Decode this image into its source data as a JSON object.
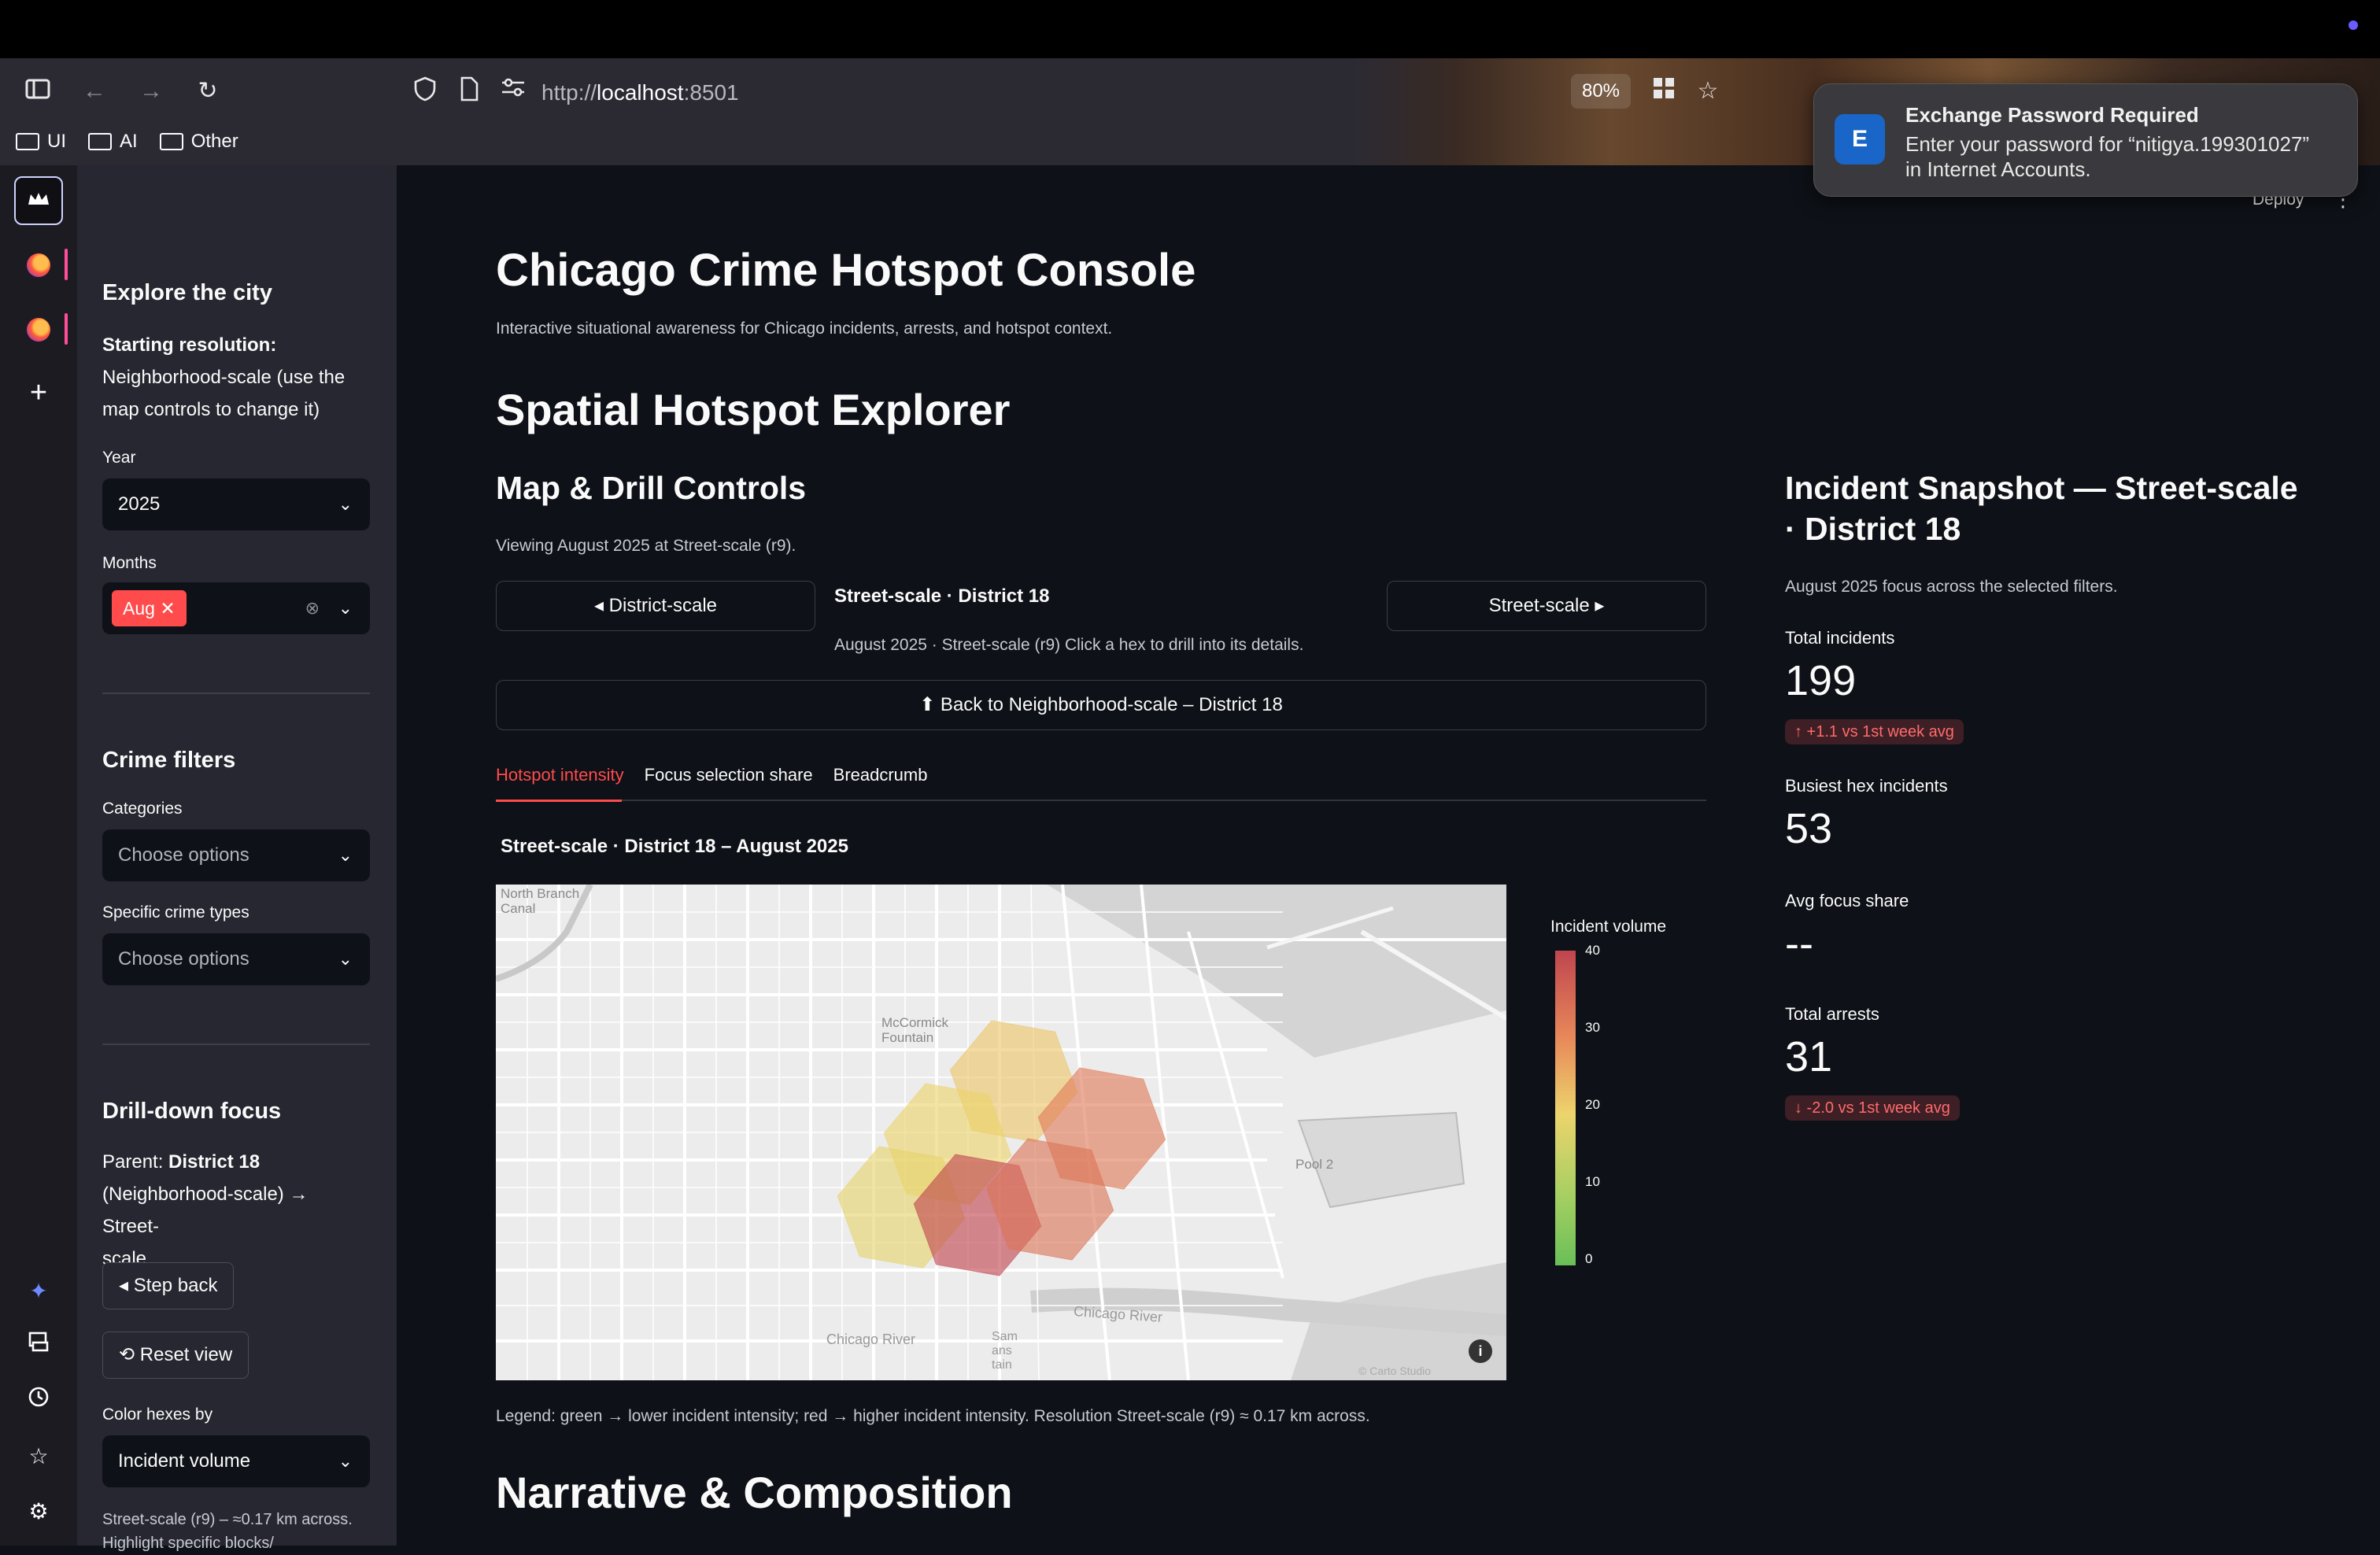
{
  "browser": {
    "url_host": "localhost",
    "url_scheme": "http://",
    "url_port": ":8501",
    "zoom": "80%",
    "bookmarks": [
      "UI",
      "AI",
      "Other"
    ]
  },
  "notification": {
    "icon_text": "E",
    "title": "Exchange Password Required",
    "body_line1": "Enter your password for “nitigya.199301027”",
    "body_line2": "in Internet Accounts."
  },
  "app": {
    "deploy_label": "Deploy",
    "title": "Chicago Crime Hotspot Console",
    "subtitle": "Interactive situational awareness for Chicago incidents, arrests, and hotspot context.",
    "section_title": "Spatial Hotspot Explorer",
    "next_section_title": "Narrative & Composition"
  },
  "sidebar": {
    "explore_heading": "Explore the city",
    "starting_res_bold": "Starting resolution:",
    "starting_res_text1": "Neighborhood-scale (use the",
    "starting_res_text2": "map controls to change it)",
    "year_label": "Year",
    "year_value": "2025",
    "months_label": "Months",
    "month_tag": "Aug",
    "crime_heading": "Crime filters",
    "categories_label": "Categories",
    "categories_placeholder": "Choose options",
    "types_label": "Specific crime types",
    "types_placeholder": "Choose options",
    "drill_heading": "Drill-down focus",
    "parent_prefix": "Parent: ",
    "parent_bold": "District 18",
    "parent_line2": "(Neighborhood-scale) → Street-",
    "parent_line3": "scale",
    "step_back": "◂ Step back",
    "reset_view": "⟲ Reset view",
    "color_by_label": "Color hexes by",
    "color_by_value": "Incident volume",
    "footer_line1": "Street-scale (r9) – ≈0.17 km across.",
    "footer_line2": "Highlight specific blocks/"
  },
  "controls": {
    "heading": "Map & Drill Controls",
    "viewing": "Viewing August 2025 at Street-scale (r9).",
    "prev_btn": "◂ District-scale",
    "current_label": "Street-scale · District 18",
    "current_caption": "August 2025 · Street-scale (r9) Click a hex to drill into its details.",
    "next_btn": "Street-scale ▸",
    "back_btn": "⬆ Back to Neighborhood-scale – District 18",
    "tabs": [
      "Hotspot intensity",
      "Focus selection share",
      "Breadcrumb"
    ],
    "map_title": "Street-scale · District 18 – August 2025",
    "legend_caption": "Legend: green → lower incident intensity; red → higher incident intensity. Resolution Street-scale (r9) ≈ 0.17 km across."
  },
  "map_labels": {
    "north_branch1": "North Branch",
    "north_branch2": "Canal",
    "mccormick1": "McCormick",
    "mccormick2": "Fountain",
    "pool": "Pool 2",
    "river": "Chicago River",
    "chicago_river2": "Chicago River",
    "sam1": "Sam",
    "sam2": "ans",
    "sam3": "tain",
    "attribution": "© Carto Studio"
  },
  "colorbar": {
    "title": "Incident volume",
    "ticks": [
      "40",
      "30",
      "20",
      "10",
      "0"
    ],
    "max": 40,
    "min": 0
  },
  "snapshot": {
    "heading_line1": "Incident Snapshot — Street-scale",
    "heading_line2": "· District 18",
    "caption": "August 2025 focus across the selected filters.",
    "metrics": [
      {
        "label": "Total incidents",
        "value": "199",
        "delta": "↑ +1.1 vs 1st week avg"
      },
      {
        "label": "Busiest hex incidents",
        "value": "53",
        "delta": ""
      },
      {
        "label": "Avg focus share",
        "value": "--",
        "delta": ""
      },
      {
        "label": "Total arrests",
        "value": "31",
        "delta": "↓ -2.0 vs 1st week avg"
      }
    ]
  },
  "hexes": [
    {
      "name": "hex-north",
      "value": 22
    },
    {
      "name": "hex-center",
      "value": 20
    },
    {
      "name": "hex-east",
      "value": 32
    },
    {
      "name": "hex-west",
      "value": 19
    },
    {
      "name": "hex-southwest",
      "value": 40
    },
    {
      "name": "hex-southeast",
      "value": 33
    }
  ],
  "colors": {
    "accent": "#ff4b4b",
    "background": "#0e1117",
    "sidebar": "#262730"
  }
}
